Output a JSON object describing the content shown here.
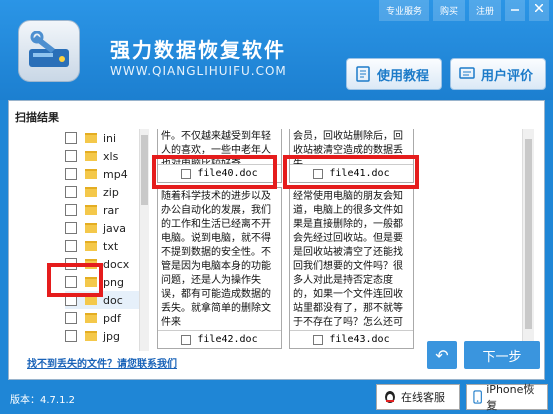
{
  "header": {
    "title": "强力数据恢复软件",
    "url": "WWW.QIANGLIHUIFU.COM",
    "top_links": [
      "专业服务",
      "购买",
      "注册"
    ],
    "tutorial_button": "使用教程",
    "review_button": "用户评价"
  },
  "panel": {
    "title": "扫描结果",
    "tree_items": [
      {
        "label": "ini"
      },
      {
        "label": "xls"
      },
      {
        "label": "mp4"
      },
      {
        "label": "zip"
      },
      {
        "label": "rar"
      },
      {
        "label": "java"
      },
      {
        "label": "txt"
      },
      {
        "label": "docx"
      },
      {
        "label": "png"
      },
      {
        "label": "doc"
      },
      {
        "label": "pdf"
      },
      {
        "label": "jpg"
      }
    ],
    "files": [
      {
        "name": "file40.doc",
        "text": "件。不仅越来越受到年轻人的喜欢，一些中老年人也对电脑比较好奇"
      },
      {
        "name": "file41.doc",
        "text": "会员，回收站删除后，回收站被清空造成的数据丢失"
      },
      {
        "name": "file42.doc",
        "text": "随着科学技术的进步以及办公自动化的发展，我们的工作和生活已经离不开电脑。说到电脑，就不得不提到数据的安全性。不管是因为电脑本身的功能问题，还是人为操作失误，都有可能造成数据的丢失。就拿简单的删除文件来"
      },
      {
        "name": "file43.doc",
        "text": "经常使用电脑的朋友会知道，电脑上的很多文件如果是直接删除的，一般都会先经过回收站。但是要是回收站被清空了还能找回我们想要的文件吗？很多人对此是持否定态度的，如果一个文件连回收站里都没有了，那不就等于不存在了吗？怎么还可"
      }
    ],
    "help_link": "找不到丢失的文件？请您联系我们",
    "back_label": "↶",
    "next_label": "下一步"
  },
  "footer": {
    "version": "版本：4.7.1.2",
    "service_button": "在线客服",
    "iphone_button": "iPhone恢复"
  },
  "colors": {
    "header_blue": "#1f86d6",
    "highlight_red": "#e51c1c",
    "button_blue": "#3a95de"
  }
}
